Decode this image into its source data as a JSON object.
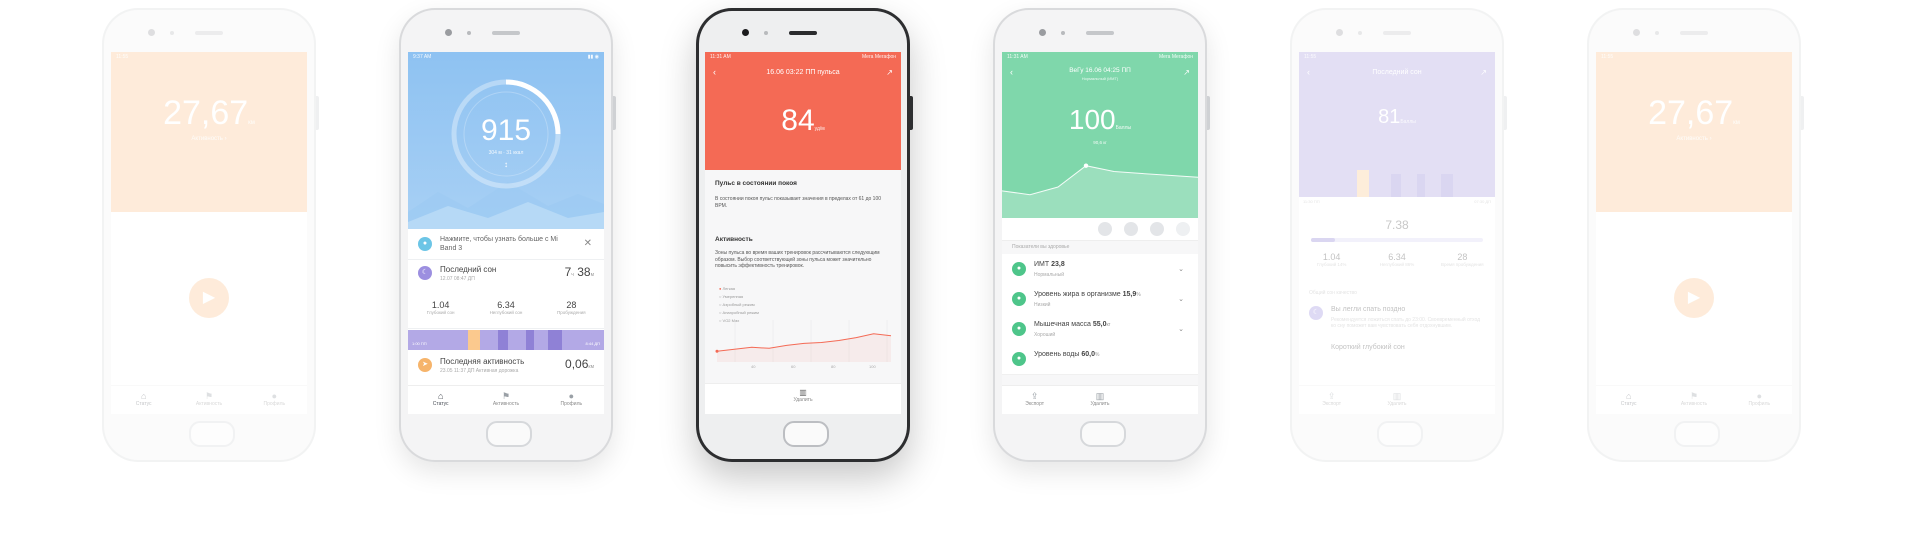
{
  "colors": {
    "orange": "#fde3c6",
    "blue": "#8ec2f2",
    "red": "#f46a55",
    "green": "#7fd7ab",
    "purple": "#d9d4f4",
    "violet": "#b3a9e6"
  },
  "tabs": [
    "Статус",
    "Активность",
    "Профиль"
  ],
  "phone1": {
    "time": "11:55",
    "value": "27,67",
    "unit": "км",
    "sub": "Активность ›",
    "play_icon": "play-icon"
  },
  "phone2": {
    "time": "9:37 AM",
    "steps": "915",
    "steps_sub": "304 м · 31 ккал",
    "banner": "Нажмите, чтобы узнать больше с Mi Band 3",
    "sleep_title": "Последний сон",
    "sleep_time": "12.07 08:47 ДП",
    "sleep_value": "7",
    "sleep_unit": "ч",
    "sleep_min": "38",
    "sleep_min_unit": "м",
    "stats": [
      {
        "v": "1.04",
        "l": "Глубокий сон"
      },
      {
        "v": "6.34",
        "l": "Неглубокий сон"
      },
      {
        "v": "28",
        "l": "Пробуждения"
      }
    ],
    "axis_left": "1:00 ПП",
    "axis_right": "8:44 ДП",
    "activity_title": "Последняя активность",
    "activity_sub": "23.05 11:37 ДП Активная дорожка",
    "activity_value": "0,06",
    "activity_unit": "км"
  },
  "phone3": {
    "time": "11:31 AM",
    "status_right": "Мега Мегафон",
    "title": "16.06 03:22 ПП пульса",
    "value": "84",
    "unit": "уд/м",
    "sec1": "Пульс в состоянии покоя",
    "para1": "В состоянии покоя пульс показывает значения в пределах от 61 до 100 BPM.",
    "sec2": "Активность",
    "para2": "Зоны пульса во время ваших тренировок рассчитываются следующим образом. Выбор соответствующей зоны пульса может значительно повысить эффективность тренировок.",
    "legend": [
      "Легкая",
      "Умеренная",
      "Аэробный режим",
      "Анаэробный режим",
      "VO2 Max"
    ],
    "x_labels": [
      "40",
      "60",
      "80",
      "100"
    ],
    "delete_label": "Удалить",
    "chart_data": {
      "type": "line",
      "x": [
        0,
        1,
        2,
        3,
        4,
        5,
        6,
        7,
        8,
        9,
        10
      ],
      "values": [
        62,
        64,
        66,
        65,
        68,
        70,
        71,
        73,
        76,
        80,
        78
      ],
      "xlabel": "",
      "ylabel": ""
    }
  },
  "phone4": {
    "time": "11:31 AM",
    "status_right": "Мега Мегафон",
    "title": "ВеГу 16.06 04:25 ПП",
    "sub": "Нормальный (ИМТ)",
    "value": "100",
    "unit": "Баллы",
    "under": "90,6 кг",
    "section": "Показатели вы здоровье",
    "rows": [
      {
        "title": "ИМТ",
        "val": "23,8",
        "unit": "",
        "sub": "Нормальный"
      },
      {
        "title": "Уровень жира в организме",
        "val": "15,9",
        "unit": "%",
        "sub": "Низкий"
      },
      {
        "title": "Мышечная масса",
        "val": "55,0",
        "unit": "кг",
        "sub": "Хороший"
      },
      {
        "title": "Уровень воды",
        "val": "60,0",
        "unit": "%",
        "sub": ""
      }
    ],
    "bottom": [
      "Экспорт",
      "Удалить"
    ],
    "chart_data": {
      "type": "area",
      "x": [
        0,
        1,
        2,
        3,
        4,
        5,
        6,
        7
      ],
      "values": [
        66,
        62,
        70,
        92,
        86,
        84,
        82,
        80
      ],
      "xlabel": "",
      "ylabel": ""
    }
  },
  "phone5": {
    "time": "11:55",
    "title": "Последний сон",
    "value": "81",
    "unit": "Баллы",
    "axis_left": "11:30 ПП",
    "axis_right": "07:30 ДП",
    "total": "7.38",
    "stats": [
      {
        "v": "1.04",
        "l": "Глубокий 14%"
      },
      {
        "v": "6.34",
        "l": "Неглубокий 86%"
      },
      {
        "v": "28",
        "l": "Время пробуждения"
      }
    ],
    "caption": "Общий сон качество",
    "tip_title": "Вы легли спать поздно",
    "tip_text": "Рекомендуется ложиться спать до 23:00. Своевременный отход ко сну поможет вам чувствовать себя отдохнувшим.",
    "tip2": "Короткий глубокий сон",
    "bottom": [
      "Экспорт",
      "Удалить"
    ]
  },
  "phone6": {
    "time": "11:55",
    "value": "27,67",
    "unit": "км",
    "sub": "Активность ›"
  }
}
